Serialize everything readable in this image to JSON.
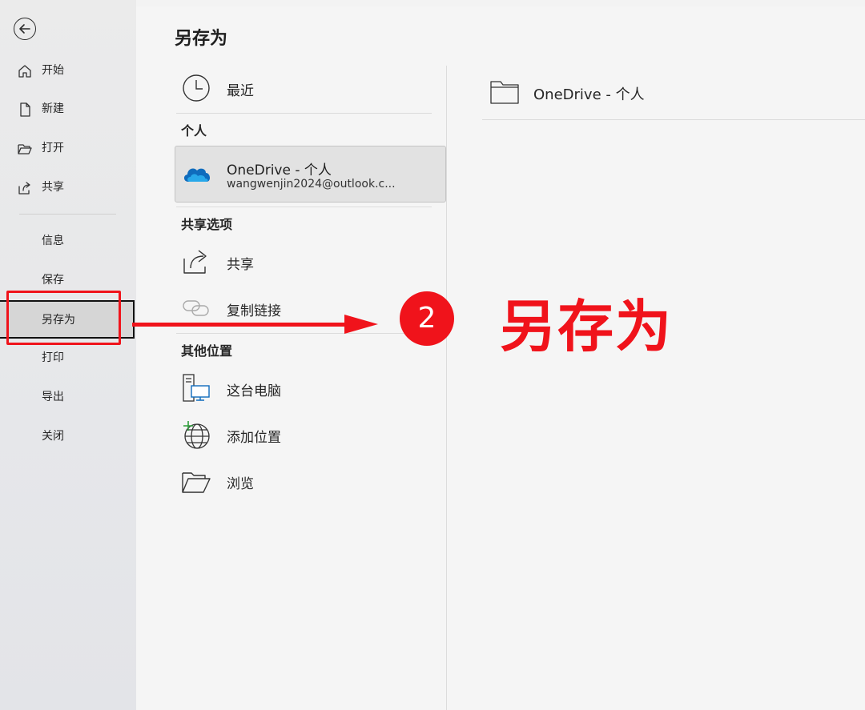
{
  "nav": {
    "items": [
      {
        "label": "开始"
      },
      {
        "label": "新建"
      },
      {
        "label": "打开"
      },
      {
        "label": "共享"
      },
      {
        "label": "信息"
      },
      {
        "label": "保存"
      },
      {
        "label": "另存为"
      },
      {
        "label": "打印"
      },
      {
        "label": "导出"
      },
      {
        "label": "关闭"
      }
    ]
  },
  "page": {
    "title": "另存为"
  },
  "locations": {
    "recent": "最近",
    "personal_header": "个人",
    "onedrive_name": "OneDrive - 个人",
    "onedrive_account": "wangwenjin2024@outlook.c...",
    "shared_header": "共享选项",
    "share": "共享",
    "copy_link": "复制链接",
    "other_header": "其他位置",
    "this_pc": "这台电脑",
    "add_place": "添加位置",
    "browse": "浏览"
  },
  "right": {
    "folder_label": "OneDrive - 个人"
  },
  "annotation": {
    "step": "2",
    "text": "另存为"
  },
  "colors": {
    "accent": "#f0131b",
    "onedrive": "#0f6cbd"
  }
}
